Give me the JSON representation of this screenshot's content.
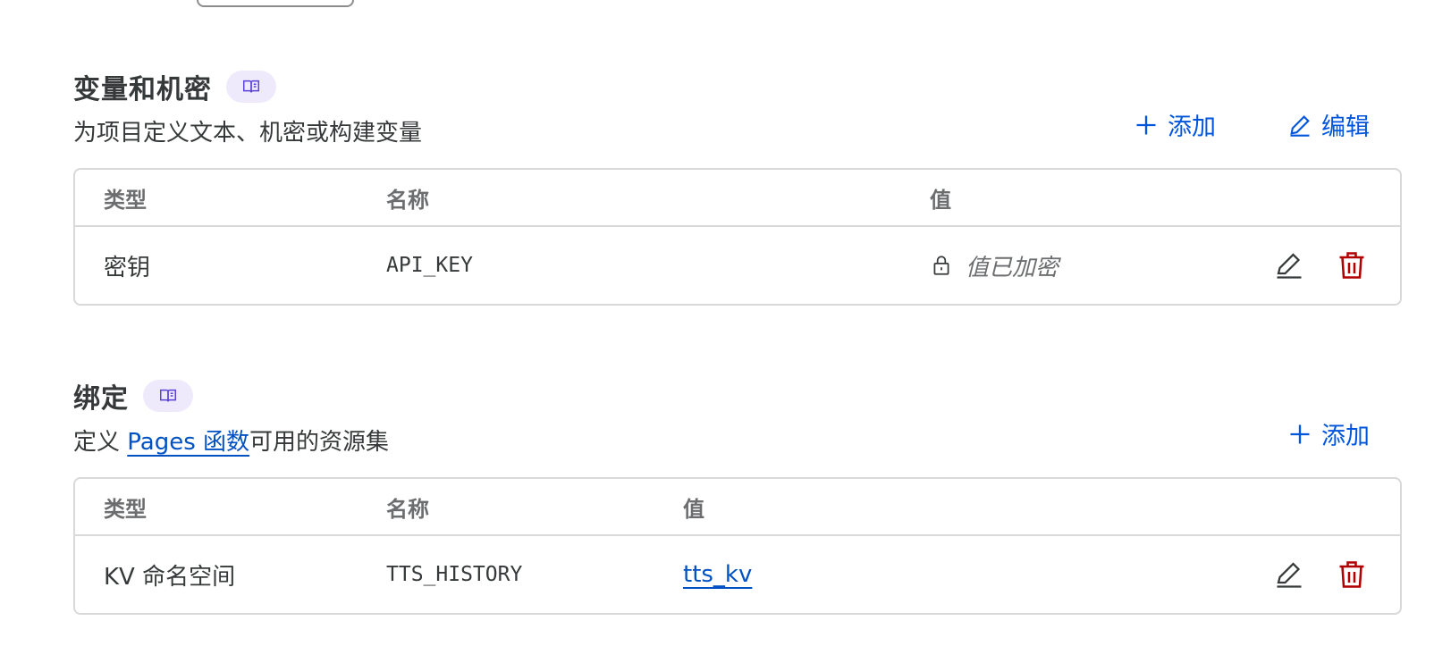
{
  "vars_section": {
    "title": "变量和机密",
    "description": "为项目定义文本、机密或构建变量",
    "add_label": "添加",
    "edit_label": "编辑",
    "columns": {
      "type": "类型",
      "name": "名称",
      "value": "值"
    },
    "rows": [
      {
        "type": "密钥",
        "name": "API_KEY",
        "value": "值已加密"
      }
    ]
  },
  "bindings_section": {
    "title": "绑定",
    "description_prefix": "定义 ",
    "description_link": "Pages 函数",
    "description_suffix": "可用的资源集",
    "add_label": "添加",
    "columns": {
      "type": "类型",
      "name": "名称",
      "value": "值"
    },
    "rows": [
      {
        "type": "KV 命名空间",
        "name": "TTS_HISTORY",
        "value": "tts_kv"
      }
    ]
  },
  "icons": {
    "docs": "book-icon",
    "add": "plus-icon",
    "edit": "pencil-icon",
    "lock": "lock-icon",
    "delete": "trash-icon"
  },
  "colors": {
    "accent": "#0055dc",
    "link": "#0051c3",
    "danger": "#b00000",
    "pill_bg": "#eeeafc",
    "border": "#d9d9d9"
  }
}
